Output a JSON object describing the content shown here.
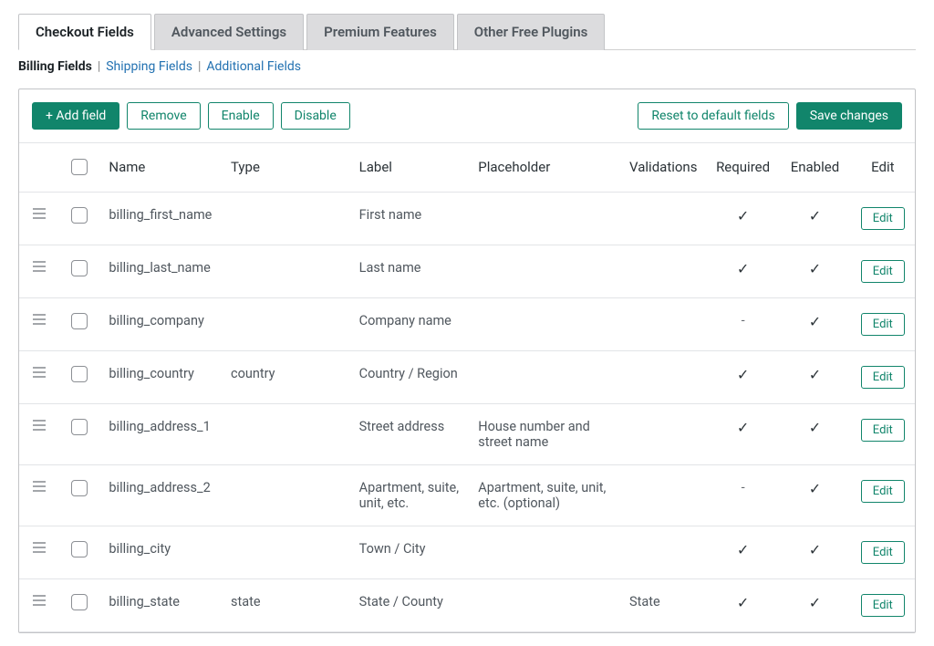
{
  "tabs": {
    "checkout_fields": "Checkout Fields",
    "advanced_settings": "Advanced Settings",
    "premium_features": "Premium Features",
    "other_free_plugins": "Other Free Plugins"
  },
  "subnav": {
    "billing": "Billing Fields",
    "shipping": "Shipping Fields",
    "additional": "Additional Fields"
  },
  "toolbar": {
    "add_field": "+ Add field",
    "remove": "Remove",
    "enable": "Enable",
    "disable": "Disable",
    "reset": "Reset to default fields",
    "save": "Save changes",
    "edit": "Edit"
  },
  "columns": {
    "name": "Name",
    "type": "Type",
    "label": "Label",
    "placeholder": "Placeholder",
    "validations": "Validations",
    "required": "Required",
    "enabled": "Enabled",
    "edit": "Edit"
  },
  "rows": [
    {
      "name": "billing_first_name",
      "type": "",
      "label": "First name",
      "placeholder": "",
      "validations": "",
      "required": "✓",
      "enabled": "✓"
    },
    {
      "name": "billing_last_name",
      "type": "",
      "label": "Last name",
      "placeholder": "",
      "validations": "",
      "required": "✓",
      "enabled": "✓"
    },
    {
      "name": "billing_company",
      "type": "",
      "label": "Company name",
      "placeholder": "",
      "validations": "",
      "required": "-",
      "enabled": "✓"
    },
    {
      "name": "billing_country",
      "type": "country",
      "label": "Country / Region",
      "placeholder": "",
      "validations": "",
      "required": "✓",
      "enabled": "✓"
    },
    {
      "name": "billing_address_1",
      "type": "",
      "label": "Street address",
      "placeholder": "House number and street name",
      "validations": "",
      "required": "✓",
      "enabled": "✓"
    },
    {
      "name": "billing_address_2",
      "type": "",
      "label": "Apartment, suite, unit, etc.",
      "placeholder": "Apartment, suite, unit, etc. (optional)",
      "validations": "",
      "required": "-",
      "enabled": "✓"
    },
    {
      "name": "billing_city",
      "type": "",
      "label": "Town / City",
      "placeholder": "",
      "validations": "",
      "required": "✓",
      "enabled": "✓"
    },
    {
      "name": "billing_state",
      "type": "state",
      "label": "State / County",
      "placeholder": "",
      "validations": "State",
      "required": "✓",
      "enabled": "✓"
    }
  ]
}
